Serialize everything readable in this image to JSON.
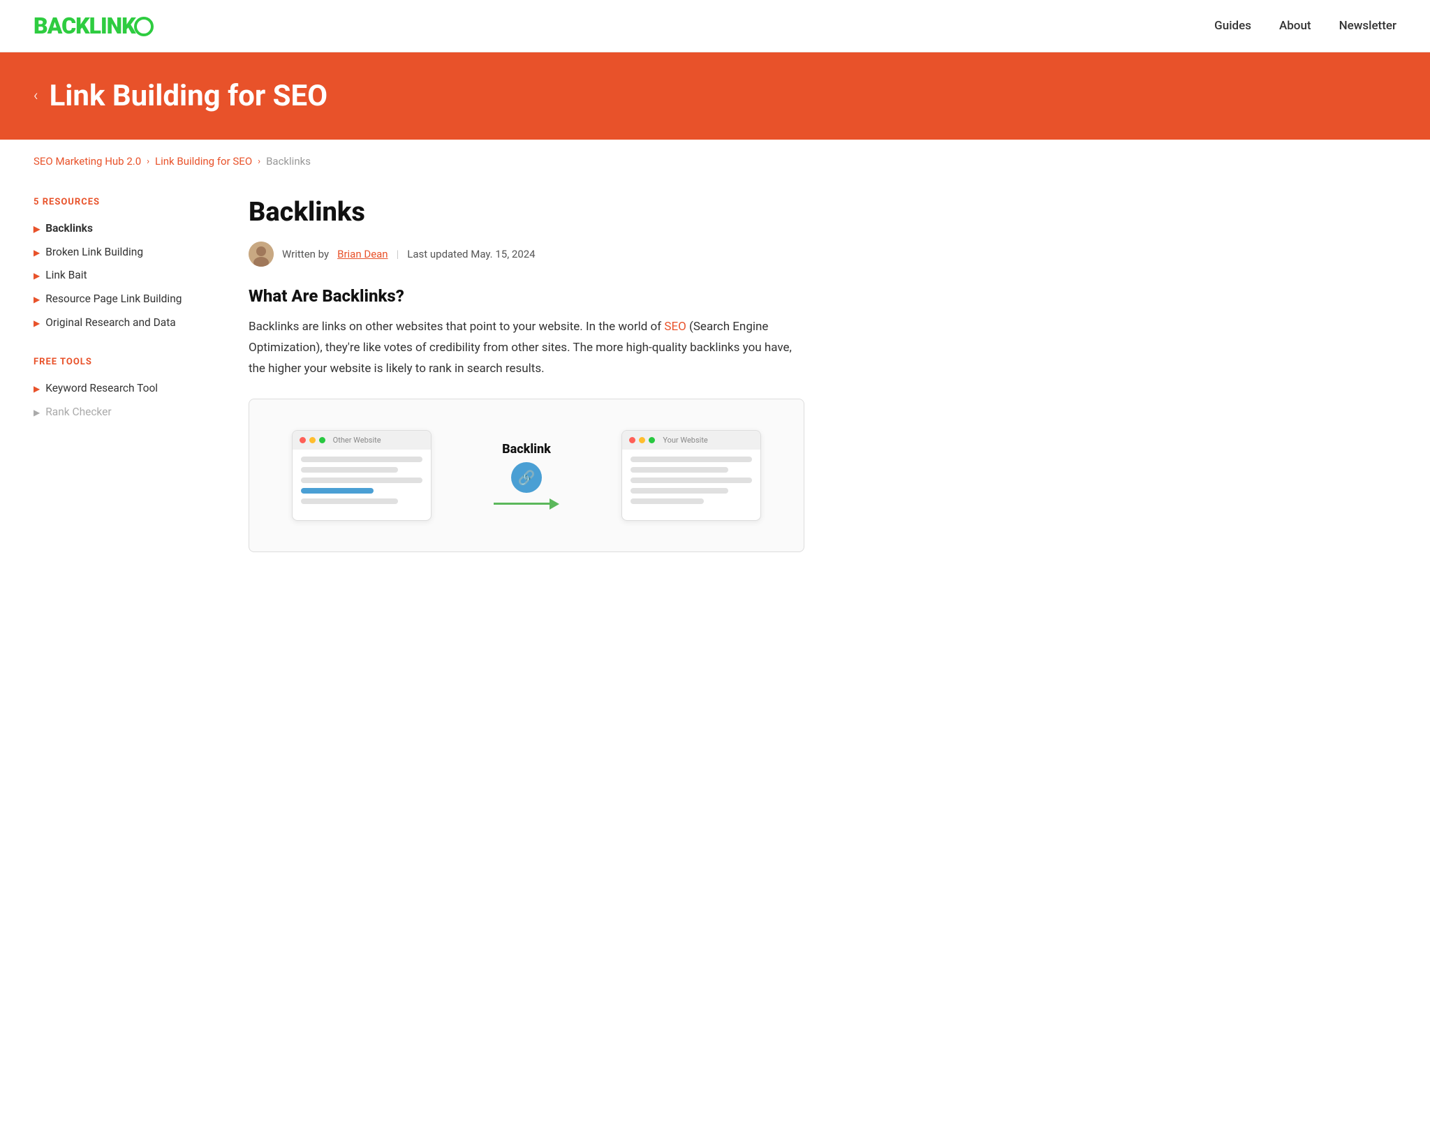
{
  "header": {
    "logo_text": "BACKLINK",
    "logo_o": "O",
    "nav_items": [
      {
        "label": "Guides",
        "href": "#"
      },
      {
        "label": "About",
        "href": "#"
      },
      {
        "label": "Newsletter",
        "href": "#"
      }
    ]
  },
  "hero": {
    "back_icon": "‹",
    "title": "Link Building for SEO"
  },
  "breadcrumb": {
    "items": [
      {
        "label": "SEO Marketing Hub 2.0",
        "href": "#",
        "type": "link"
      },
      {
        "label": "›",
        "type": "sep"
      },
      {
        "label": "Link Building for SEO",
        "href": "#",
        "type": "link"
      },
      {
        "label": "›",
        "type": "sep"
      },
      {
        "label": "Backlinks",
        "type": "current"
      }
    ]
  },
  "sidebar": {
    "section1_label": "5 RESOURCES",
    "resources": [
      {
        "label": "Backlinks",
        "active": true
      },
      {
        "label": "Broken Link Building",
        "active": false
      },
      {
        "label": "Link Bait",
        "active": false
      },
      {
        "label": "Resource Page Link Building",
        "active": false
      },
      {
        "label": "Original Research and Data",
        "active": false
      }
    ],
    "section2_label": "FREE TOOLS",
    "tools": [
      {
        "label": "Keyword Research Tool",
        "active": false
      },
      {
        "label": "Rank Checker",
        "active": false,
        "disabled": true
      }
    ]
  },
  "content": {
    "title": "Backlinks",
    "author": {
      "prefix": "Written by",
      "name": "Brian Dean",
      "pipe": "|",
      "updated": "Last updated May. 15, 2024"
    },
    "section1_heading": "What Are Backlinks?",
    "section1_body_part1": "Backlinks are links on other websites that point to your website. In the world of ",
    "section1_seo_link": "SEO",
    "section1_body_part2": " (Search Engine Optimization), they're like votes of credibility from other sites. The more high-quality backlinks you have, the higher your website is likely to rank in search results.",
    "illustration": {
      "left_label": "Other Website",
      "right_label": "Your Website",
      "backlink_label": "Backlink"
    }
  },
  "colors": {
    "brand_orange": "#e8522a",
    "brand_green": "#2ecc40",
    "arrow_green": "#5bb85b",
    "link_blue": "#4a9fd4"
  }
}
